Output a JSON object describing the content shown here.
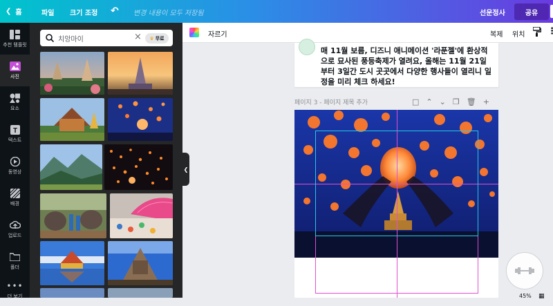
{
  "topbar": {
    "home": "홈",
    "file": "파일",
    "resize": "크기 조정",
    "saved": "변경 내용이 모두 저장됨",
    "subscribe": "선운정사",
    "share": "공유"
  },
  "rail": {
    "items": [
      {
        "label": "추천 템플릿",
        "icon": "template-icon"
      },
      {
        "label": "사진",
        "icon": "photo-icon"
      },
      {
        "label": "요소",
        "icon": "elements-icon"
      },
      {
        "label": "텍스트",
        "icon": "text-icon"
      },
      {
        "label": "동영상",
        "icon": "video-icon"
      },
      {
        "label": "배경",
        "icon": "background-icon"
      },
      {
        "label": "업로드",
        "icon": "upload-icon"
      },
      {
        "label": "폴더",
        "icon": "folder-icon"
      },
      {
        "label": "더 보기",
        "icon": "more-icon"
      }
    ]
  },
  "panel": {
    "search_value": "치앙마이",
    "free_badge": "무료"
  },
  "toolbar": {
    "crop": "자르기",
    "copy": "복제",
    "position": "위치"
  },
  "canvas": {
    "page2_text": "매 11월 보름, 디즈니 애니메이션 '라푼젤'에 환상적으로 묘사된 풍등축제가 열려요, 올해는 11월 21일부터 3일간 도시 곳곳에서 다양한 행사들이 열리니 일정을 미리 체크 하세요!",
    "page3_label": "페이지 3 - 페이지 제목 추가",
    "zoom": "45%"
  },
  "colors": {
    "accent_cyan": "#00c4cc",
    "accent_purple": "#6a3be0",
    "guide_magenta": "#e050d0",
    "selection_cyan": "#29c8e6"
  }
}
